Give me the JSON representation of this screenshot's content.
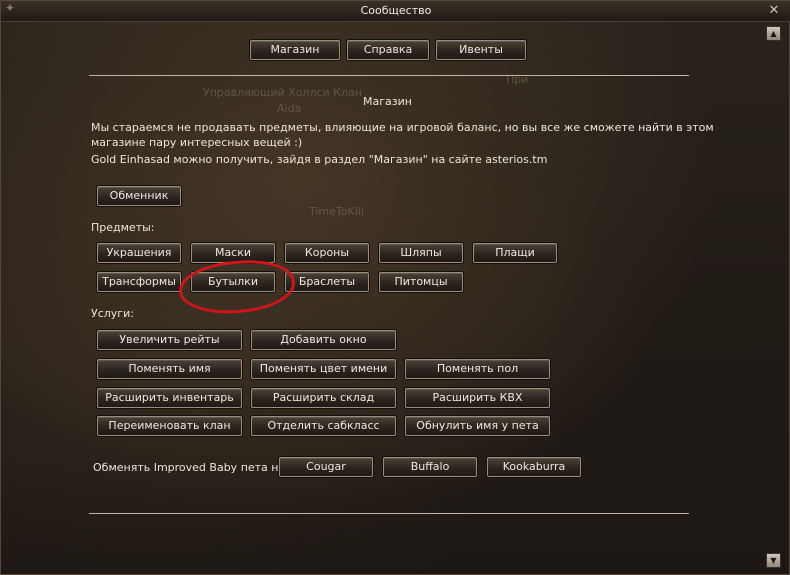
{
  "window": {
    "title": "Сообщество"
  },
  "tabs": [
    "Магазин",
    "Справка",
    "Ивенты"
  ],
  "background_ghost": {
    "line1": "Управляющий Холлси Клан",
    "line2": "Aida",
    "line3": "TimeToKill",
    "line4": "При"
  },
  "section_title": "Магазин",
  "intro": {
    "line1": "Мы стараемся не продавать предметы, влияющие на игровой баланс, но вы все же сможете найти в этом",
    "line2": "магазине пару интересных вещей :)",
    "line3": "Gold Einhasad можно получить, зайдя в раздел \"Магазин\" на сайте asterios.tm"
  },
  "exchanger_button": "Обменник",
  "items_label": "Предметы:",
  "items_row1": [
    "Украшения",
    "Маски",
    "Короны",
    "Шляпы",
    "Плащи"
  ],
  "items_row2": [
    "Трансформы",
    "Бутылки",
    "Браслеты",
    "Питомцы"
  ],
  "services_label": "Услуги:",
  "services": {
    "row1": [
      "Увеличить рейты",
      "Добавить окно"
    ],
    "row2": [
      "Поменять имя",
      "Поменять цвет имени",
      "Поменять пол"
    ],
    "row3": [
      "Расширить инвентарь",
      "Расширить склад",
      "Расширить КВХ"
    ],
    "row4": [
      "Переименовать клан",
      "Отделить сабкласс",
      "Обнулить имя у пета"
    ]
  },
  "exchange_label": "Обменять Improved Baby пета на:",
  "exchange_options": [
    "Cougar",
    "Buffalo",
    "Kookaburra"
  ],
  "colors": {
    "accent_gold": "#e5b53c",
    "annotation_red": "#d01616"
  }
}
